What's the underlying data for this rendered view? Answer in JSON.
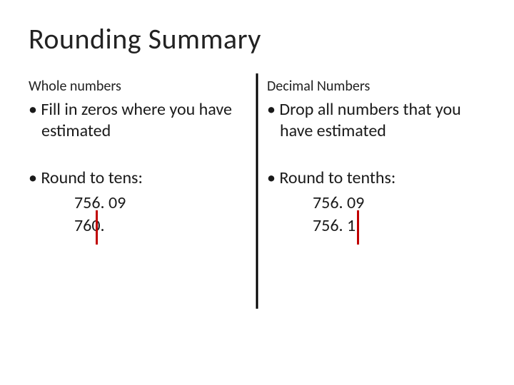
{
  "title": "Rounding Summary",
  "left": {
    "heading": "Whole numbers",
    "bullet1": "Fill in zeros where you have estimated",
    "bullet2": "Round to tens:",
    "example1": "756. 09",
    "example2": "760."
  },
  "right": {
    "heading": "Decimal Numbers",
    "bullet1": "Drop all numbers that you have estimated",
    "bullet2": "Round to tenths:",
    "example1": "756. 09",
    "example2": "756. 1"
  }
}
